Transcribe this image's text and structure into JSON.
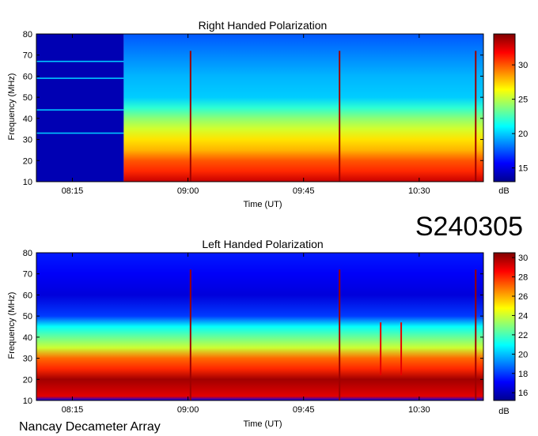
{
  "page": {
    "observation_id": "S240305",
    "instrument_footer": "Nancay Decameter Array"
  },
  "colors": {
    "colormap": [
      "#00008f",
      "#0000ff",
      "#0080ff",
      "#00ffff",
      "#80ff80",
      "#ffff00",
      "#ff8000",
      "#ff0000",
      "#800000"
    ]
  },
  "chart_data": [
    {
      "type": "heatmap",
      "title": "Right Handed Polarization",
      "xlabel": "Time (UT)",
      "ylabel": "Frequency (MHz)",
      "xlim": [
        "08:01",
        "10:55"
      ],
      "ylim": [
        10,
        80
      ],
      "x_ticks": [
        "08:15",
        "09:00",
        "09:45",
        "10:30"
      ],
      "y_ticks": [
        10,
        20,
        30,
        40,
        50,
        60,
        70,
        80
      ],
      "colorbar": {
        "label": "dB",
        "ticks": [
          15,
          20,
          25,
          30
        ],
        "range": [
          13,
          34.5
        ]
      },
      "features": {
        "data_gap_until": "08:35",
        "vertical_bursts": [
          "09:01",
          "09:59",
          "10:52"
        ],
        "interference_lines_mhz": [
          59,
          44,
          33,
          67
        ],
        "band_levels_db": [
          [
            10,
            33
          ],
          [
            15,
            31
          ],
          [
            20,
            30
          ],
          [
            25,
            28
          ],
          [
            30,
            27
          ],
          [
            35,
            25.5
          ],
          [
            40,
            24
          ],
          [
            45,
            22
          ],
          [
            50,
            20
          ],
          [
            60,
            19.5
          ],
          [
            70,
            18.5
          ],
          [
            80,
            17.5
          ]
        ]
      }
    },
    {
      "type": "heatmap",
      "title": "Left Handed Polarization",
      "xlabel": "Time (UT)",
      "ylabel": "Frequency (MHz)",
      "xlim": [
        "08:01",
        "10:55"
      ],
      "ylim": [
        10,
        80
      ],
      "x_ticks": [
        "08:15",
        "09:00",
        "09:45",
        "10:30"
      ],
      "y_ticks": [
        10,
        20,
        30,
        40,
        50,
        60,
        70,
        80
      ],
      "colorbar": {
        "label": "dB",
        "ticks": [
          16,
          18,
          20,
          22,
          24,
          26,
          28,
          30
        ],
        "range": [
          15.2,
          30.5
        ]
      },
      "features": {
        "vertical_bursts": [
          "09:01",
          "09:59",
          "10:52"
        ],
        "short_bursts": [
          "10:15",
          "10:23"
        ],
        "band_levels_db": [
          [
            10,
            17
          ],
          [
            12,
            29
          ],
          [
            20,
            30
          ],
          [
            25,
            28
          ],
          [
            30,
            27
          ],
          [
            35,
            24
          ],
          [
            40,
            22.5
          ],
          [
            45,
            21
          ],
          [
            50,
            18
          ],
          [
            60,
            16.5
          ],
          [
            70,
            17
          ],
          [
            80,
            17.5
          ]
        ]
      }
    }
  ]
}
